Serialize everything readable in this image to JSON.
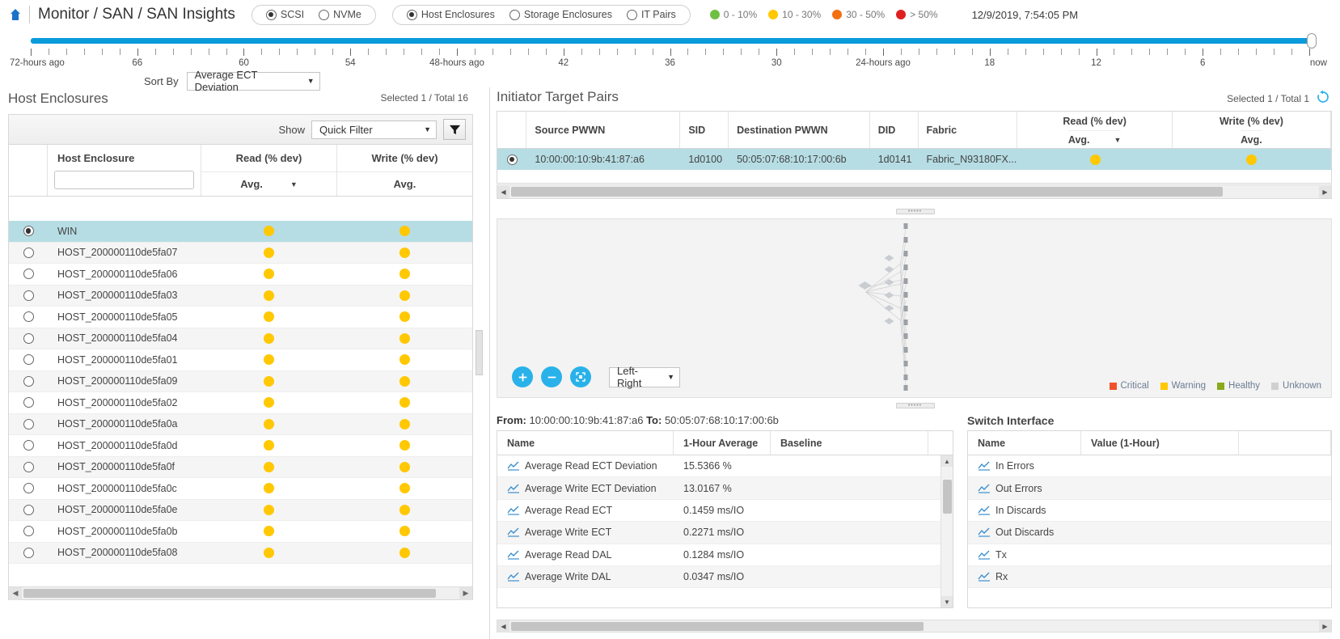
{
  "header": {
    "title": "Monitor / SAN / SAN Insights",
    "home_icon": "home-icon",
    "protocol_options": [
      {
        "label": "SCSI",
        "selected": true
      },
      {
        "label": "NVMe",
        "selected": false
      }
    ],
    "view_options": [
      {
        "label": "Host Enclosures",
        "selected": true
      },
      {
        "label": "Storage Enclosures",
        "selected": false
      },
      {
        "label": "IT Pairs",
        "selected": false
      }
    ],
    "deviation_legend": [
      {
        "label": "0 - 10%",
        "color": "#6fbf44"
      },
      {
        "label": "10 - 30%",
        "color": "#ffc800"
      },
      {
        "label": "30 - 50%",
        "color": "#f2700f"
      },
      {
        "label": "> 50%",
        "color": "#e02020"
      }
    ],
    "timestamp": "12/9/2019, 7:54:05 PM"
  },
  "timeline": {
    "labels": [
      {
        "text": "72-hours ago",
        "pos": 0
      },
      {
        "text": "66",
        "pos": 8.333
      },
      {
        "text": "60",
        "pos": 16.666
      },
      {
        "text": "54",
        "pos": 25.0
      },
      {
        "text": "48-hours ago",
        "pos": 33.333
      },
      {
        "text": "42",
        "pos": 41.666
      },
      {
        "text": "36",
        "pos": 50.0
      },
      {
        "text": "30",
        "pos": 58.333
      },
      {
        "text": "24-hours ago",
        "pos": 66.666
      },
      {
        "text": "18",
        "pos": 75.0
      },
      {
        "text": "12",
        "pos": 83.333
      },
      {
        "text": "6",
        "pos": 91.666
      },
      {
        "text": "now",
        "pos": 100
      }
    ],
    "track_color": "#0a9bdb",
    "handle_position": "now"
  },
  "sort": {
    "label": "Sort By",
    "value": "Average ECT Deviation"
  },
  "left_panel": {
    "title": "Host Enclosures",
    "selected_total": "Selected 1 / Total 16",
    "show_label": "Show",
    "quick_filter_value": "Quick Filter",
    "funnel_icon": "filter-funnel-icon",
    "columns": {
      "name": "Host Enclosure",
      "read": "Read (% dev)",
      "write": "Write (% dev)",
      "avg": "Avg."
    },
    "filter_input_value": "",
    "rows": [
      {
        "name": "WIN",
        "read": "#ffc800",
        "write": "#ffc800",
        "selected": true
      },
      {
        "name": "HOST_200000110de5fa07",
        "read": "#ffc800",
        "write": "#ffc800",
        "selected": false
      },
      {
        "name": "HOST_200000110de5fa06",
        "read": "#ffc800",
        "write": "#ffc800",
        "selected": false
      },
      {
        "name": "HOST_200000110de5fa03",
        "read": "#ffc800",
        "write": "#ffc800",
        "selected": false
      },
      {
        "name": "HOST_200000110de5fa05",
        "read": "#ffc800",
        "write": "#ffc800",
        "selected": false
      },
      {
        "name": "HOST_200000110de5fa04",
        "read": "#ffc800",
        "write": "#ffc800",
        "selected": false
      },
      {
        "name": "HOST_200000110de5fa01",
        "read": "#ffc800",
        "write": "#ffc800",
        "selected": false
      },
      {
        "name": "HOST_200000110de5fa09",
        "read": "#ffc800",
        "write": "#ffc800",
        "selected": false
      },
      {
        "name": "HOST_200000110de5fa02",
        "read": "#ffc800",
        "write": "#ffc800",
        "selected": false
      },
      {
        "name": "HOST_200000110de5fa0a",
        "read": "#ffc800",
        "write": "#ffc800",
        "selected": false
      },
      {
        "name": "HOST_200000110de5fa0d",
        "read": "#ffc800",
        "write": "#ffc800",
        "selected": false
      },
      {
        "name": "HOST_200000110de5fa0f",
        "read": "#ffc800",
        "write": "#ffc800",
        "selected": false
      },
      {
        "name": "HOST_200000110de5fa0c",
        "read": "#ffc800",
        "write": "#ffc800",
        "selected": false
      },
      {
        "name": "HOST_200000110de5fa0e",
        "read": "#ffc800",
        "write": "#ffc800",
        "selected": false
      },
      {
        "name": "HOST_200000110de5fa0b",
        "read": "#ffc800",
        "write": "#ffc800",
        "selected": false
      },
      {
        "name": "HOST_200000110de5fa08",
        "read": "#ffc800",
        "write": "#ffc800",
        "selected": false
      }
    ]
  },
  "itp_panel": {
    "title": "Initiator Target Pairs",
    "selected_total": "Selected 1 / Total 1",
    "refresh_icon": "refresh-icon",
    "columns": {
      "source_pwwn": "Source PWWN",
      "sid": "SID",
      "destination_pwwn": "Destination PWWN",
      "did": "DID",
      "fabric": "Fabric",
      "read": "Read (% dev)",
      "write": "Write (% dev)",
      "avg": "Avg."
    },
    "rows": [
      {
        "source_pwwn": "10:00:00:10:9b:41:87:a6",
        "sid": "1d0100",
        "destination_pwwn": "50:05:07:68:10:17:00:6b",
        "did": "1d0141",
        "fabric": "Fabric_N93180FX...",
        "read_color": "#ffc800",
        "write_color": "#ffc800",
        "selected": true
      }
    ]
  },
  "topology": {
    "zoom_in_icon": "plus-icon",
    "zoom_out_icon": "minus-icon",
    "fit_icon": "fit-screen-icon",
    "layout_value": "Left-Right",
    "legend": [
      {
        "label": "Critical",
        "color": "#f0532b"
      },
      {
        "label": "Warning",
        "color": "#ffc800"
      },
      {
        "label": "Healthy",
        "color": "#8aa91b"
      },
      {
        "label": "Unknown",
        "color": "#d0d0d0"
      }
    ]
  },
  "metrics_panel": {
    "from_label": "From:",
    "from_value": "10:00:00:10:9b:41:87:a6",
    "to_label": "To:",
    "to_value": "50:05:07:68:10:17:00:6b",
    "columns": {
      "name": "Name",
      "hour_average": "1-Hour Average",
      "baseline": "Baseline"
    },
    "rows": [
      {
        "name": "Average Read ECT Deviation",
        "value": "15.5366 %",
        "baseline": ""
      },
      {
        "name": "Average Write ECT Deviation",
        "value": "13.0167 %",
        "baseline": ""
      },
      {
        "name": "Average Read ECT",
        "value": "0.1459 ms/IO",
        "baseline": ""
      },
      {
        "name": "Average Write ECT",
        "value": "0.2271 ms/IO",
        "baseline": ""
      },
      {
        "name": "Average Read DAL",
        "value": "0.1284 ms/IO",
        "baseline": ""
      },
      {
        "name": "Average Write DAL",
        "value": "0.0347 ms/IO",
        "baseline": ""
      }
    ]
  },
  "switch_interface": {
    "title": "Switch Interface",
    "columns": {
      "name": "Name",
      "value": "Value (1-Hour)"
    },
    "rows": [
      {
        "name": "In Errors",
        "value": ""
      },
      {
        "name": "Out Errors",
        "value": ""
      },
      {
        "name": "In Discards",
        "value": ""
      },
      {
        "name": "Out Discards",
        "value": ""
      },
      {
        "name": "Tx",
        "value": ""
      },
      {
        "name": "Rx",
        "value": ""
      }
    ]
  }
}
